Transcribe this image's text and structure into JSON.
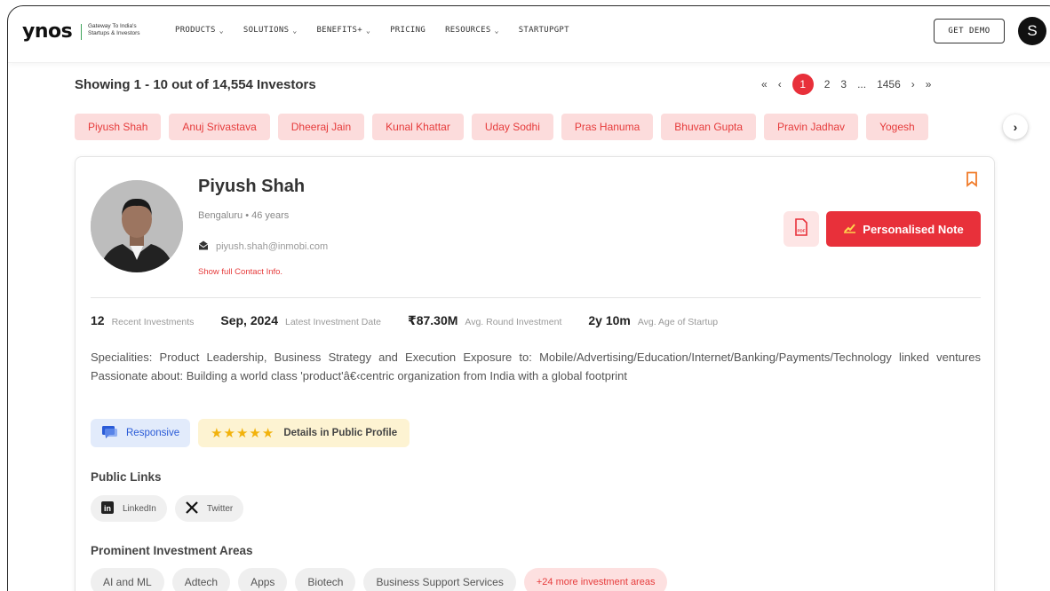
{
  "brand": {
    "logo": "ynos",
    "tagline": "Gateway To India's Startups & Investors"
  },
  "nav": {
    "items": [
      {
        "label": "PRODUCTS",
        "dropdown": true
      },
      {
        "label": "SOLUTIONS",
        "dropdown": true
      },
      {
        "label": "BENEFITS+",
        "dropdown": true
      },
      {
        "label": "PRICING",
        "dropdown": false
      },
      {
        "label": "RESOURCES",
        "dropdown": true
      },
      {
        "label": "STARTUPGPT",
        "dropdown": false
      }
    ],
    "get_demo": "GET DEMO",
    "user_initial": "S"
  },
  "results": {
    "showing": "Showing 1 - 10 out of 14,554 Investors"
  },
  "pagination": {
    "first": "«",
    "prev": "‹",
    "pages": [
      "1",
      "2",
      "3"
    ],
    "ellipsis": "...",
    "last_page": "1456",
    "next": "›",
    "last": "»",
    "current": "1"
  },
  "investor_chips": [
    "Piyush Shah",
    "Anuj Srivastava",
    "Dheeraj Jain",
    "Kunal Khattar",
    "Uday Sodhi",
    "Pras Hanuma",
    "Bhuvan Gupta",
    "Pravin Jadhav",
    "Yogesh"
  ],
  "profile": {
    "name": "Piyush Shah",
    "location_age": "Bengaluru • 46 years",
    "email": "piyush.shah@inmobi.com",
    "show_contact": "Show full Contact Info.",
    "note_button": "Personalised Note",
    "stats": [
      {
        "value": "12",
        "label": "Recent Investments"
      },
      {
        "value": "Sep, 2024",
        "label": "Latest Investment Date"
      },
      {
        "value": "₹87.30M",
        "label": "Avg. Round Investment"
      },
      {
        "value": "2y 10m",
        "label": "Avg. Age of Startup"
      }
    ],
    "bio": "Specialities: Product Leadership, Business Strategy and Execution Exposure to: Mobile/Advertising/Education/Internet/Banking/Payments/Technology linked ventures Passionate about: Building a world class 'product'â€‹centric organization from India with a global footprint",
    "badges": {
      "responsive": "Responsive",
      "public_profile": "Details in Public Profile",
      "stars": "★★★★★"
    },
    "public_links_title": "Public Links",
    "links": [
      {
        "label": "LinkedIn",
        "icon": "linkedin-icon"
      },
      {
        "label": "Twitter",
        "icon": "x-twitter-icon"
      }
    ],
    "investment_areas_title": "Prominent Investment Areas",
    "investment_areas": [
      "AI and ML",
      "Adtech",
      "Apps",
      "Biotech",
      "Business Support Services"
    ],
    "more_areas": "+24 more investment areas"
  },
  "colors": {
    "accent_red": "#e8303a",
    "chip_pink": "#fcdcdc",
    "responsive_blue": "#e2ebfb",
    "star_yellow": "#f2b20c"
  }
}
